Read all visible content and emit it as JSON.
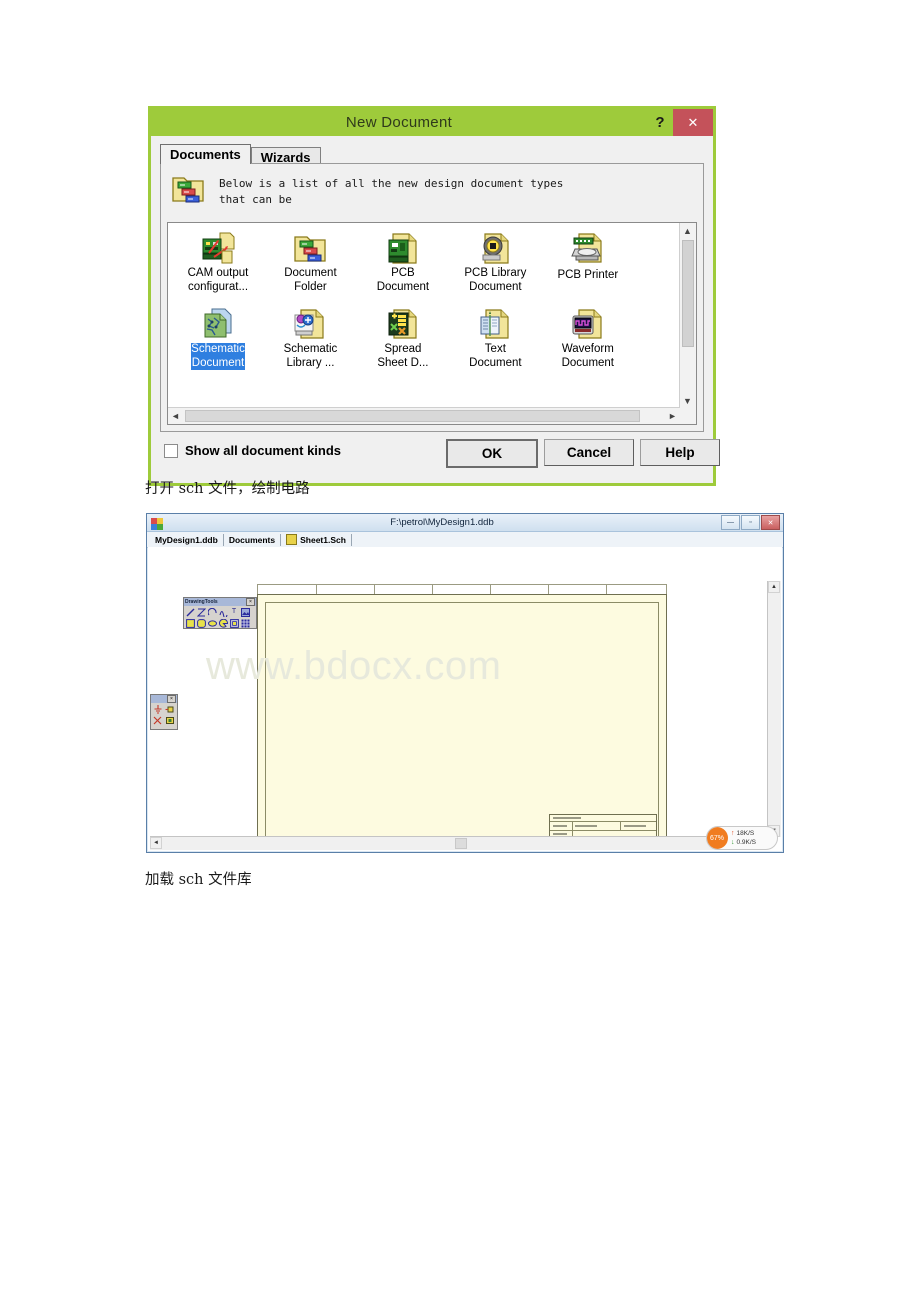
{
  "dialog": {
    "title": "New Document",
    "help_button": "?",
    "close_button": "✕",
    "tabs": [
      {
        "label": "Documents",
        "active": true
      },
      {
        "label": "Wizards",
        "active": false
      }
    ],
    "hint_icon": "document-folder-icon",
    "hint_text": "Below is a list of all the new design document types\nthat can be",
    "documents": [
      {
        "label": "CAM output\nconfigurat...",
        "icon": "cam-output-icon",
        "selected": false
      },
      {
        "label": "Document\nFolder",
        "icon": "document-folder-icon",
        "selected": false
      },
      {
        "label": "PCB\nDocument",
        "icon": "pcb-document-icon",
        "selected": false
      },
      {
        "label": "PCB Library\nDocument",
        "icon": "pcb-library-icon",
        "selected": false
      },
      {
        "label": "PCB Printer",
        "icon": "pcb-printer-icon",
        "selected": false
      },
      {
        "label": "Schematic\nDocument",
        "icon": "schematic-document-icon",
        "selected": true
      },
      {
        "label": "Schematic\nLibrary ...",
        "icon": "schematic-library-icon",
        "selected": false
      },
      {
        "label": "Spread\nSheet D...",
        "icon": "spreadsheet-document-icon",
        "selected": false
      },
      {
        "label": "Text\nDocument",
        "icon": "text-document-icon",
        "selected": false
      },
      {
        "label": "Waveform\nDocument",
        "icon": "waveform-document-icon",
        "selected": false
      }
    ],
    "show_all_checkbox": {
      "label": "Show all document kinds",
      "checked": false
    },
    "buttons": {
      "ok": "OK",
      "cancel": "Cancel",
      "help": "Help"
    },
    "colors": {
      "titlebar": "#9ecb3b",
      "close": "#c4525a",
      "selection": "#2f7fe0"
    }
  },
  "captions": {
    "line1": "打开 sch 文件，绘制电路",
    "line2": "加载 sch 文件库"
  },
  "protel": {
    "title": "F:\\petrol\\MyDesign1.ddb",
    "app_icon": "protel-app-icon",
    "window_buttons": {
      "minimize": "—",
      "maximize": "▫",
      "close": "✕"
    },
    "tabs": [
      {
        "label": "MyDesign1.ddb",
        "icon": null
      },
      {
        "label": "Documents",
        "icon": null
      },
      {
        "label": "Sheet1.Sch",
        "icon": "schematic-sheet-icon"
      }
    ],
    "watermark": "www.bdocx.com",
    "drawing_tools": {
      "title": "DrawingTools",
      "close_button": "×",
      "row1": [
        "line-tool",
        "polyline-tool",
        "arc-tool",
        "bezier-tool",
        "text-tool",
        "image-tool"
      ],
      "row2": [
        "rectangle-tool",
        "round-rect-tool",
        "ellipse-tool",
        "pie-tool",
        "frame-tool",
        "array-tool"
      ]
    },
    "left_palette": {
      "close_button": "×",
      "buttons": [
        "ground-tool",
        "power-tool",
        "netlabel-tool",
        "port-tool"
      ]
    },
    "net_overlay": {
      "percent": "67%",
      "upload": "18K/S",
      "download": "0.9K/S",
      "up_arrow": "↑",
      "down_arrow": "↓"
    }
  }
}
